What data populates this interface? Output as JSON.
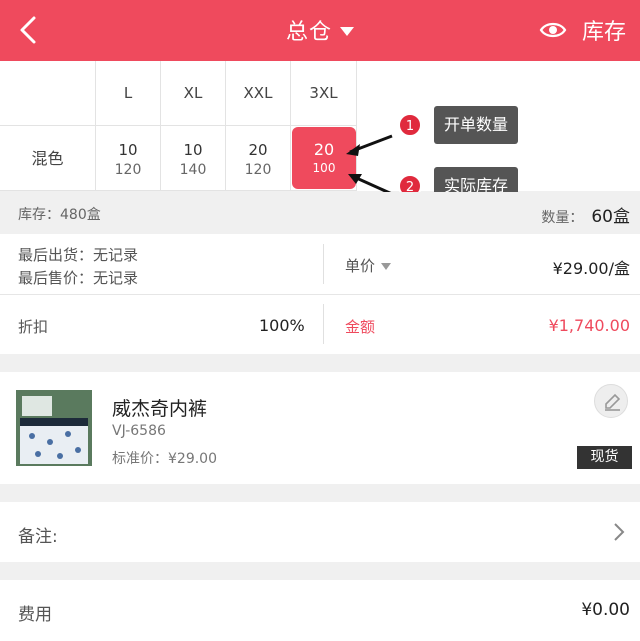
{
  "header": {
    "title": "总仓",
    "right_label": "库存",
    "accent": "#ef4a5d"
  },
  "grid": {
    "sizes": [
      "L",
      "XL",
      "XXL",
      "3XL"
    ],
    "color": "混色",
    "order_qty": [
      "10",
      "10",
      "20",
      "20"
    ],
    "actual_stock": [
      "120",
      "140",
      "120",
      "100"
    ]
  },
  "callouts": [
    {
      "num": "1",
      "text": "开单数量"
    },
    {
      "num": "2",
      "text": "实际库存"
    }
  ],
  "stock_bar": {
    "stock_text": "库存：480盒",
    "qty_label": "数量：",
    "qty_value": "60盒"
  },
  "info": {
    "last_ship": "最后出货：无记录",
    "last_sale": "最后售价：无记录",
    "unit_price_label": "单价",
    "unit_price": "¥29.00/盒",
    "discount_label": "折扣",
    "discount": "100%",
    "amount_label": "金额",
    "amount": "¥1,740.00"
  },
  "product": {
    "name": "威杰奇内裤",
    "code": "VJ-6586",
    "std_price": "标准价：¥29.00",
    "badge": "现货"
  },
  "remark": {
    "label": "备注:"
  },
  "fee": {
    "label": "费用",
    "value": "¥0.00"
  }
}
